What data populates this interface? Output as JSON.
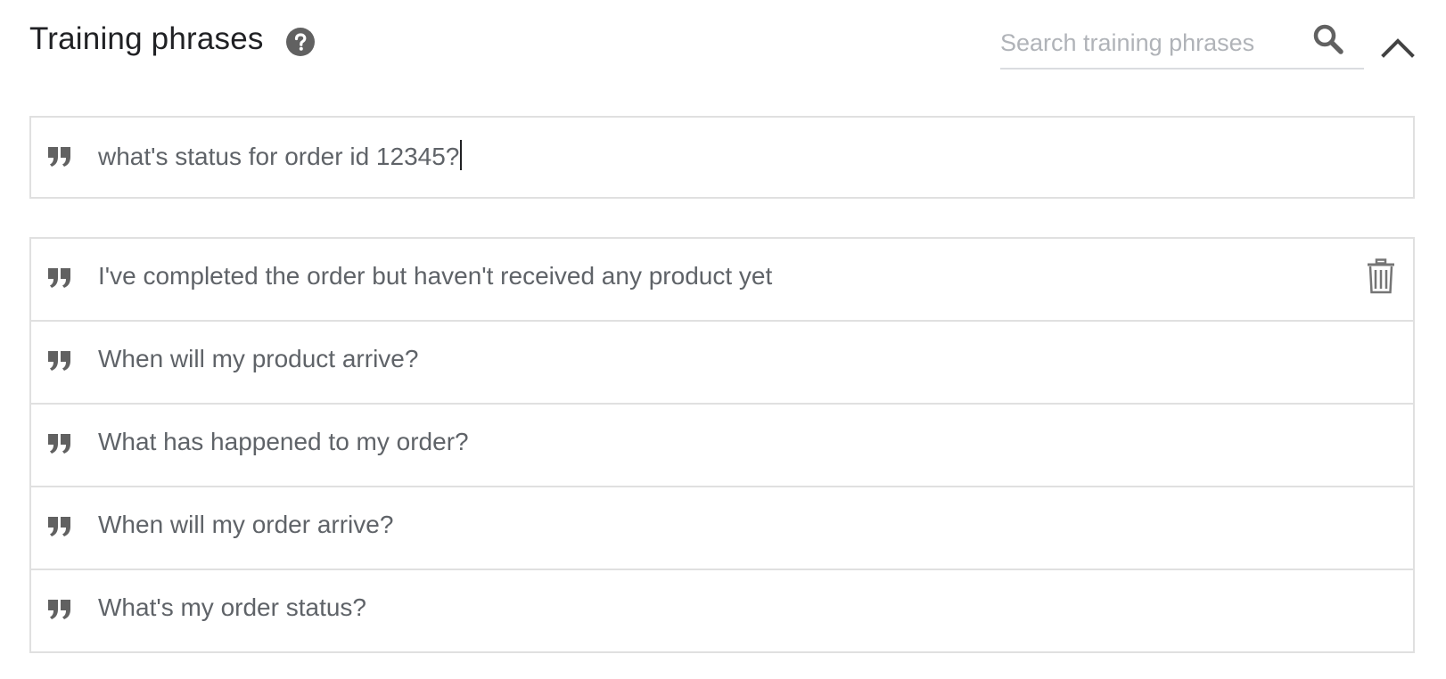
{
  "header": {
    "title": "Training phrases",
    "help_icon": "help-circle-icon",
    "search": {
      "placeholder": "Search training phrases",
      "value": "",
      "icon": "search-icon"
    },
    "collapse_icon": "chevron-up-icon"
  },
  "new_phrase": {
    "icon": "quote-icon",
    "value": "what's status for order id 12345?"
  },
  "phrases": [
    {
      "text": "I've completed the order but haven't received any product yet",
      "delete_icon": "trash-icon"
    },
    {
      "text": "When will my product arrive?"
    },
    {
      "text": "What has happened to my order?"
    },
    {
      "text": "When will my order arrive?"
    },
    {
      "text": "What's my order status?"
    }
  ],
  "colors": {
    "title": "#202124",
    "text": "#5f6368",
    "border": "#e0e0e0",
    "icon": "#616161",
    "placeholder": "#b0b3b8"
  }
}
